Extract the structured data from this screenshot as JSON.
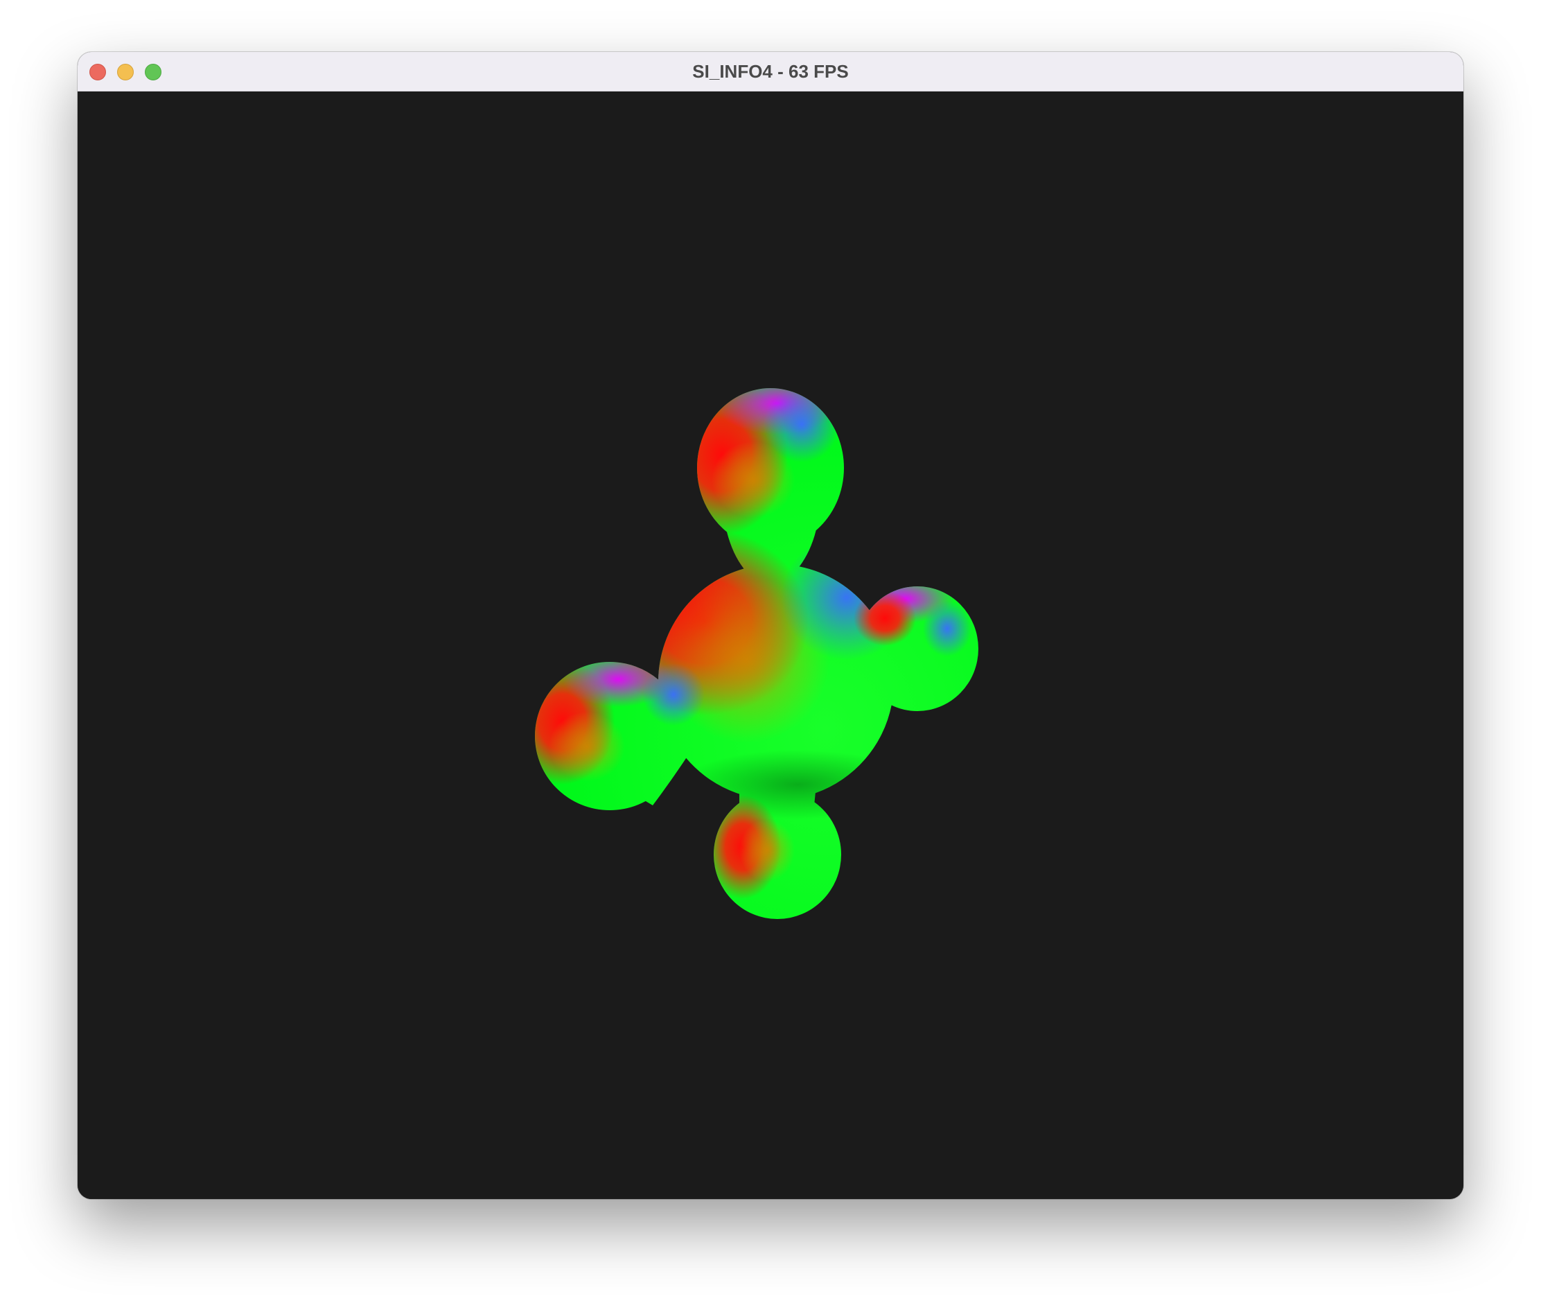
{
  "window": {
    "title": "SI_INFO4 - 63 FPS",
    "controls": {
      "close": "close-icon",
      "minimize": "minimize-icon",
      "maximize": "maximize-icon"
    }
  },
  "viewport": {
    "background": "#1b1b1b",
    "object": "metaball-molecule",
    "shading": "normal-map colors (red, green, blue, magenta)"
  },
  "colors": {
    "titlebar": "#efedf3",
    "close": "#ec6a5f",
    "minimize": "#f4bf50",
    "maximize": "#61c555",
    "red": "#ff1a1a",
    "green": "#00ff1f",
    "blue": "#3a6dff",
    "magenta": "#ff00ff"
  }
}
